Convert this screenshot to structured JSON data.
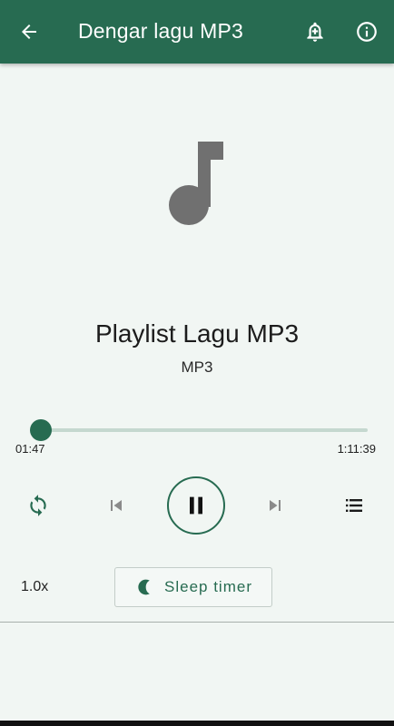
{
  "colors": {
    "primary": "#276b51",
    "background": "#f1f6f3",
    "artwork": "#707070"
  },
  "toolbar": {
    "title": "Dengar lagu MP3",
    "icons": [
      "back-arrow-icon",
      "bell-add-icon",
      "info-icon"
    ]
  },
  "track": {
    "title": "Playlist Lagu MP3",
    "subtitle": "MP3"
  },
  "player": {
    "current_time": "01:47",
    "total_time": "1:11:39",
    "progress_fraction": 0.025,
    "state": "playing"
  },
  "controls": {
    "icons": [
      "repeat-icon",
      "skip-previous-icon",
      "pause-icon",
      "skip-next-icon",
      "playlist-icon"
    ]
  },
  "options": {
    "speed": "1.0x",
    "sleep_timer_label": "Sleep timer",
    "sleep_timer_icon": "moon-icon"
  }
}
